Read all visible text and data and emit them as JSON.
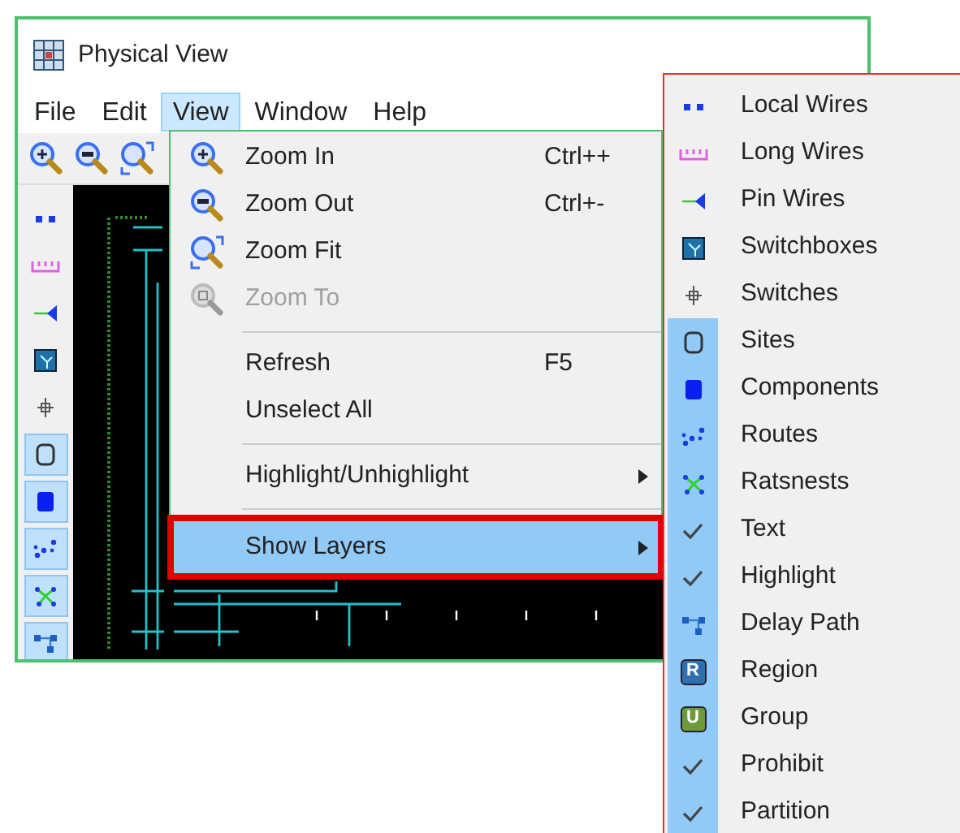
{
  "window": {
    "title": "Physical View"
  },
  "menu_bar": [
    {
      "label": "File",
      "selected": false
    },
    {
      "label": "Edit",
      "selected": false
    },
    {
      "label": "View",
      "selected": true
    },
    {
      "label": "Window",
      "selected": false
    },
    {
      "label": "Help",
      "selected": false
    }
  ],
  "side_toolbar": [
    {
      "kind": "local-wires",
      "pressed": false
    },
    {
      "kind": "long-wires",
      "pressed": false
    },
    {
      "kind": "pin-wires",
      "pressed": false
    },
    {
      "kind": "switchbox",
      "pressed": false
    },
    {
      "kind": "switches",
      "pressed": false
    },
    {
      "kind": "sites",
      "pressed": true
    },
    {
      "kind": "components",
      "pressed": true
    },
    {
      "kind": "routes",
      "pressed": true
    },
    {
      "kind": "ratsnests",
      "pressed": true
    },
    {
      "kind": "delay-path",
      "pressed": true
    }
  ],
  "view_menu": [
    {
      "kind": "zoom-in",
      "label": "Zoom In",
      "shortcut": "Ctrl++",
      "disabled": false,
      "selected": false
    },
    {
      "kind": "zoom-out",
      "label": "Zoom Out",
      "shortcut": "Ctrl+-",
      "disabled": false,
      "selected": false
    },
    {
      "kind": "zoom-fit",
      "label": "Zoom Fit",
      "disabled": false,
      "selected": false
    },
    {
      "kind": "zoom-to",
      "label": "Zoom To",
      "disabled": true,
      "selected": false
    },
    {
      "kind": "separator"
    },
    {
      "kind": "plain",
      "label": "Refresh",
      "shortcut": "F5",
      "disabled": false,
      "selected": false
    },
    {
      "kind": "plain",
      "label": "Unselect All",
      "disabled": false,
      "selected": false
    },
    {
      "kind": "separator"
    },
    {
      "kind": "submenu",
      "label": "Highlight/Unhighlight",
      "disabled": false,
      "selected": false
    },
    {
      "kind": "separator"
    },
    {
      "kind": "submenu",
      "label": "Show Layers",
      "disabled": false,
      "selected": true
    }
  ],
  "layers_menu": [
    {
      "kind": "local-wires",
      "label": "Local Wires",
      "checked": false
    },
    {
      "kind": "long-wires",
      "label": "Long Wires",
      "checked": false
    },
    {
      "kind": "pin-wires",
      "label": "Pin Wires",
      "checked": false
    },
    {
      "kind": "switchbox",
      "label": "Switchboxes",
      "checked": false
    },
    {
      "kind": "switches",
      "label": "Switches",
      "checked": false
    },
    {
      "kind": "sites",
      "label": "Sites",
      "checked": true
    },
    {
      "kind": "components",
      "label": "Components",
      "checked": true
    },
    {
      "kind": "routes",
      "label": "Routes",
      "checked": true
    },
    {
      "kind": "ratsnests",
      "label": "Ratsnests",
      "checked": true
    },
    {
      "kind": "check",
      "label": "Text",
      "checked": true
    },
    {
      "kind": "check",
      "label": "Highlight",
      "checked": true
    },
    {
      "kind": "delay-path",
      "label": "Delay Path",
      "checked": true
    },
    {
      "kind": "region",
      "badge": "R",
      "label": "Region",
      "checked": true
    },
    {
      "kind": "group",
      "badge": "U",
      "label": "Group",
      "checked": true
    },
    {
      "kind": "check",
      "label": "Prohibit",
      "checked": true
    },
    {
      "kind": "check",
      "label": "Partition",
      "checked": true
    }
  ]
}
